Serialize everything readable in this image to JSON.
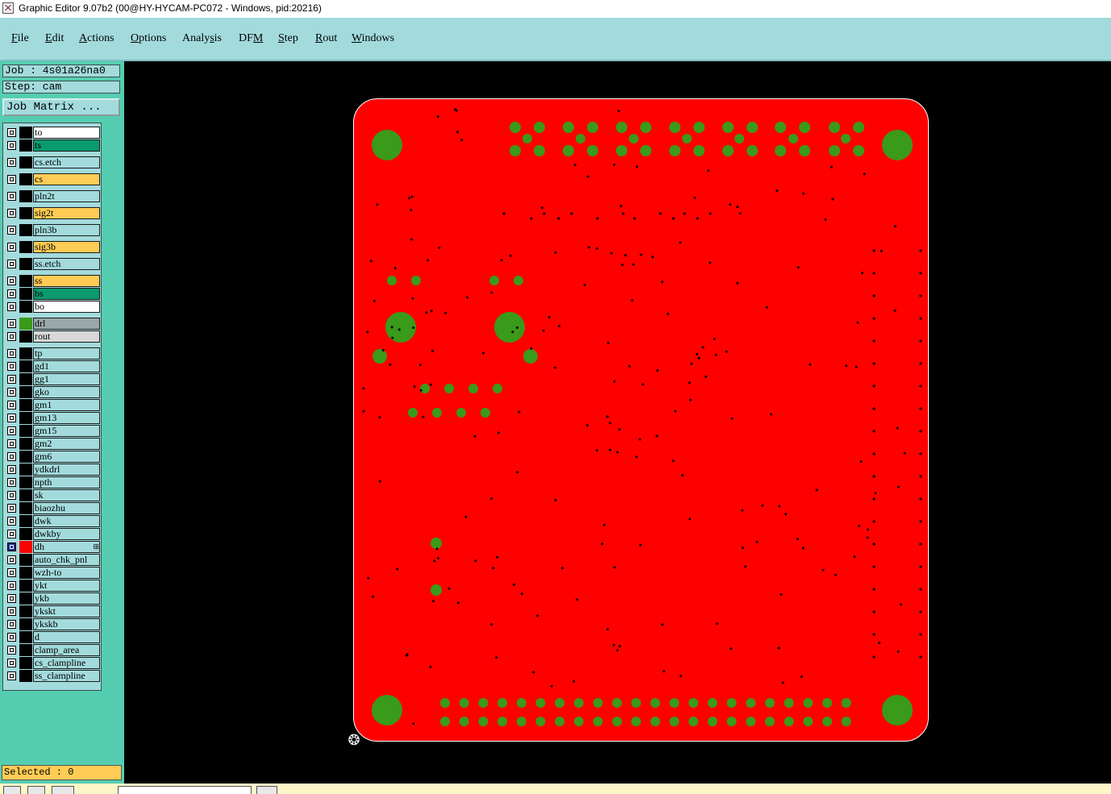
{
  "window": {
    "title": "Graphic Editor 9.07b2 (00@HY-HYCAM-PC072 - Windows, pid:20216)"
  },
  "menu": [
    {
      "pre": "",
      "ul": "F",
      "post": "ile"
    },
    {
      "pre": "",
      "ul": "E",
      "post": "dit"
    },
    {
      "pre": "",
      "ul": "A",
      "post": "ctions"
    },
    {
      "pre": "",
      "ul": "O",
      "post": "ptions"
    },
    {
      "pre": "Analy",
      "ul": "s",
      "post": "is"
    },
    {
      "pre": "DF",
      "ul": "M",
      "post": ""
    },
    {
      "pre": "",
      "ul": "S",
      "post": "tep"
    },
    {
      "pre": "",
      "ul": "R",
      "post": "out"
    },
    {
      "pre": "",
      "ul": "W",
      "post": "indows"
    }
  ],
  "job": {
    "job_label": "Job : 4s01a26na0",
    "step_label": "Step: cam",
    "matrix_button": "Job Matrix ..."
  },
  "layers": [
    {
      "name": "to",
      "color": "#ffffff",
      "swatch": "#000000"
    },
    {
      "name": "ts",
      "color": "#0a9a6e",
      "swatch": "#000000"
    },
    {
      "name": "cs.etch",
      "color": "#a3dbdd",
      "swatch": "#000000"
    },
    {
      "name": "cs",
      "color": "#ffcc55",
      "swatch": "#000000"
    },
    {
      "name": "pln2t",
      "color": "#a3dbdd",
      "swatch": "#000000"
    },
    {
      "name": "sig2t",
      "color": "#ffcc55",
      "swatch": "#000000"
    },
    {
      "name": "pln3b",
      "color": "#a3dbdd",
      "swatch": "#000000"
    },
    {
      "name": "sig3b",
      "color": "#ffcc55",
      "swatch": "#000000"
    },
    {
      "name": "ss.etch",
      "color": "#a3dbdd",
      "swatch": "#000000"
    },
    {
      "name": "ss",
      "color": "#ffcc55",
      "swatch": "#000000"
    },
    {
      "name": "bs",
      "color": "#0a9a6e",
      "swatch": "#000000"
    },
    {
      "name": "bo",
      "color": "#ffffff",
      "swatch": "#000000"
    },
    {
      "name": "drl",
      "color": "#9aa8aa",
      "swatch": "#3a9a1a"
    },
    {
      "name": "rout",
      "color": "#d8d8d8",
      "swatch": "#000000"
    },
    {
      "name": "tp",
      "color": "#a3dbdd",
      "swatch": "#000000"
    },
    {
      "name": "gd1",
      "color": "#a3dbdd",
      "swatch": "#000000"
    },
    {
      "name": "gg1",
      "color": "#a3dbdd",
      "swatch": "#000000"
    },
    {
      "name": "gko",
      "color": "#a3dbdd",
      "swatch": "#000000"
    },
    {
      "name": "gm1",
      "color": "#a3dbdd",
      "swatch": "#000000"
    },
    {
      "name": "gm13",
      "color": "#a3dbdd",
      "swatch": "#000000"
    },
    {
      "name": "gm15",
      "color": "#a3dbdd",
      "swatch": "#000000"
    },
    {
      "name": "gm2",
      "color": "#a3dbdd",
      "swatch": "#000000"
    },
    {
      "name": "gm6",
      "color": "#a3dbdd",
      "swatch": "#000000"
    },
    {
      "name": "ydkdrl",
      "color": "#a3dbdd",
      "swatch": "#000000"
    },
    {
      "name": "npth",
      "color": "#a3dbdd",
      "swatch": "#000000"
    },
    {
      "name": "sk",
      "color": "#a3dbdd",
      "swatch": "#000000"
    },
    {
      "name": "biaozhu",
      "color": "#a3dbdd",
      "swatch": "#000000"
    },
    {
      "name": "dwk",
      "color": "#a3dbdd",
      "swatch": "#000000"
    },
    {
      "name": "dwkby",
      "color": "#a3dbdd",
      "swatch": "#000000"
    },
    {
      "name": "dh",
      "color": "#a3dbdd",
      "swatch": "#ff0000",
      "active": true
    },
    {
      "name": "auto_chk_pnl",
      "color": "#a3dbdd",
      "swatch": "#000000"
    },
    {
      "name": "wzh-to",
      "color": "#a3dbdd",
      "swatch": "#000000"
    },
    {
      "name": "ykt",
      "color": "#a3dbdd",
      "swatch": "#000000"
    },
    {
      "name": "ykb",
      "color": "#a3dbdd",
      "swatch": "#000000"
    },
    {
      "name": "ykskt",
      "color": "#a3dbdd",
      "swatch": "#000000"
    },
    {
      "name": "ykskb",
      "color": "#a3dbdd",
      "swatch": "#000000"
    },
    {
      "name": "d",
      "color": "#a3dbdd",
      "swatch": "#000000"
    },
    {
      "name": "clamp_area",
      "color": "#a3dbdd",
      "swatch": "#000000"
    },
    {
      "name": "cs_clampline",
      "color": "#a3dbdd",
      "swatch": "#000000"
    },
    {
      "name": "ss_clampline",
      "color": "#a3dbdd",
      "swatch": "#000000"
    }
  ],
  "status": {
    "selected": "Selected : 0"
  },
  "colors": {
    "board": "#ff0000",
    "pad": "#3a9a1a",
    "hole": "#000000",
    "menubar": "#a3dbdd",
    "panel": "#55cdb0"
  }
}
